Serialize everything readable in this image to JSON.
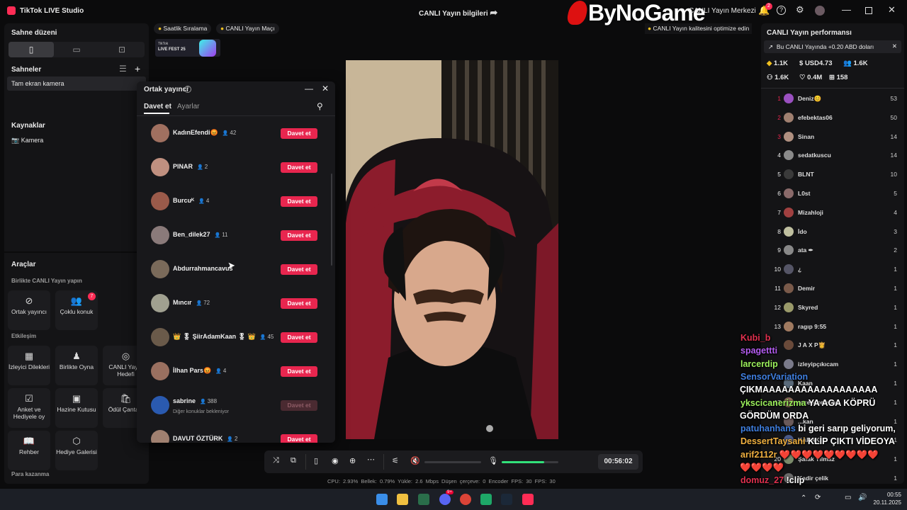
{
  "window": {
    "app_title": "TikTok LIVE Studio",
    "live_info": "CANLI Yayın bilgileri",
    "live_center": "CANLI Yayın Merkezi",
    "notif_count": "2"
  },
  "brand": {
    "text": "ByNoGame"
  },
  "left": {
    "scene_layout_title": "Sahne düzeni",
    "scenes_title": "Sahneler",
    "scene_item": "Tam ekran kamera",
    "sources_title": "Kaynaklar",
    "source_item": "Kamera",
    "tools_title": "Araçlar",
    "together_title": "Birlikte CANLI Yayın yapın",
    "cohost": "Ortak yayıncı",
    "multi_guest": "Çoklu konuk",
    "multi_badge": "7",
    "engagement_title": "Etkileşim",
    "viewer_wishes": "İzleyici Dilekleri",
    "play_together": "Birlikte Oyna",
    "live_goal": "CANLI Yayın Hedefi",
    "poll": "Anket ve Hediyele oy",
    "treasure": "Hazine Kutusu",
    "reward_bag": "Ödül Çantası",
    "guide": "Rehber",
    "gift_gallery": "Hediye Galerisi",
    "monetize_title": "Para kazanma"
  },
  "top_chips": {
    "hourly": "Saatlik Sıralama",
    "match": "CANLI Yayın Maçı",
    "fest_line1": "TikTok",
    "fest_line2": "LIVE FEST 25",
    "quality_tip": "CANLI Yayın kalitesini optimize edin"
  },
  "modal": {
    "title": "Ortak yayıncı",
    "tab_invite": "Davet et",
    "tab_settings": "Ayarlar",
    "invite_label": "Davet et",
    "waiting_text": "Diğer konuklar bekleniyor",
    "rows": [
      {
        "name": "KadınEfendi😡",
        "count": "42",
        "disabled": false
      },
      {
        "name": "PINAR",
        "count": "2",
        "disabled": false
      },
      {
        "name": "Burcuᴷ",
        "count": "4",
        "disabled": false
      },
      {
        "name": "Ben_dilek27",
        "count": "11",
        "disabled": false
      },
      {
        "name": "Abdurrahmancavus",
        "count": "",
        "disabled": false
      },
      {
        "name": "Mıncır",
        "count": "72",
        "disabled": false
      },
      {
        "name": "👑 🎖 ŞiirAdamKaan 🎖 👑",
        "count": "45",
        "disabled": false
      },
      {
        "name": "İlhan Pars😡",
        "count": "4",
        "disabled": false
      },
      {
        "name": "sabrine",
        "count": "388",
        "disabled": true
      },
      {
        "name": "DAVUT ÖZTÜRK",
        "count": "2",
        "disabled": false
      }
    ]
  },
  "controls": {
    "timer": "00:56:02",
    "mic_level_pct": 75
  },
  "stats": {
    "text": "CPU: 2.93%   Bellek: 0.79%   Yükle: 2.6 Mbps   Düşen çerçeve: 0   Encoder FPS: 30   FPS: 30"
  },
  "right": {
    "title": "CANLI Yayın performansı",
    "banner": "Bu CANLI Yayında +0.20 ABD doları",
    "metrics": [
      "1.1K",
      "USD4.73",
      "1.6K",
      "1.6K",
      "0.4M",
      "158"
    ],
    "ranking": [
      {
        "rank": "1",
        "name": "Deniz😊",
        "value": "53"
      },
      {
        "rank": "2",
        "name": "efebektas06",
        "value": "50"
      },
      {
        "rank": "3",
        "name": "Sinan",
        "value": "14"
      },
      {
        "rank": "4",
        "name": "sedatkuscu",
        "value": "14"
      },
      {
        "rank": "5",
        "name": "BLNT",
        "value": "10"
      },
      {
        "rank": "6",
        "name": "L0st",
        "value": "5"
      },
      {
        "rank": "7",
        "name": "Mizahloji",
        "value": "4"
      },
      {
        "rank": "8",
        "name": "İdo",
        "value": "3"
      },
      {
        "rank": "9",
        "name": "ata ✒",
        "value": "2"
      },
      {
        "rank": "10",
        "name": "¿",
        "value": "1"
      },
      {
        "rank": "11",
        "name": "Demir",
        "value": "1"
      },
      {
        "rank": "12",
        "name": "Skyred",
        "value": "1"
      },
      {
        "rank": "13",
        "name": "ragıp 9:55",
        "value": "1"
      },
      {
        "rank": "",
        "name": "J A X P👸",
        "value": "1"
      },
      {
        "rank": "",
        "name": "izleyipçıkıcam",
        "value": "1"
      },
      {
        "rank": "",
        "name": "Kaan",
        "value": "1"
      },
      {
        "rank": "17",
        "name": "recepcorleone",
        "value": "1"
      },
      {
        "rank": "",
        "name": "...kan",
        "value": "1"
      },
      {
        "rank": "",
        "name": "KARAK",
        "value": "1"
      },
      {
        "rank": "20",
        "name": "Şafak Yılmaz",
        "value": "1"
      },
      {
        "rank": "",
        "name": "Kadir çelik",
        "value": "1"
      }
    ]
  },
  "chat": [
    {
      "user": "Kubi_b",
      "msg": "",
      "color": "#e0304e"
    },
    {
      "user": "spagettti",
      "msg": "",
      "color": "#b35cf0"
    },
    {
      "user": "larcerdip",
      "msg": "",
      "color": "#9cf05c"
    },
    {
      "user": "SensorVariation",
      "msg": "",
      "color": "#3f7fe0"
    },
    {
      "user": "",
      "msg": "ÇIKMAAAAAAAAAAAAAAAAAA",
      "color": "#ffffff"
    },
    {
      "user": "ykscicanerizma",
      "msg": "YA AGA KÖPRÜ",
      "color": "#9cf05c"
    },
    {
      "user": "",
      "msg": "GÖRDÜM ORDA",
      "color": "#ffffff"
    },
    {
      "user": "patuhanhans",
      "msg": "bi geri sarıp geliyorum,",
      "color": "#3f7fe0"
    },
    {
      "user": "DessertTaysani",
      "msg": "KLİP ÇIKTI VİDEOYA",
      "color": "#f0b040"
    },
    {
      "user": "arif2112r",
      "msg": "❤️❤️❤️❤️❤️❤️❤️❤️❤️",
      "color": "#f0b040"
    },
    {
      "user": "",
      "msg": "❤️❤️❤️❤️",
      "color": "#ffffff"
    },
    {
      "user": "domuz_27",
      "msg": "!clip",
      "color": "#e0304e"
    }
  ],
  "taskbar": {
    "time": "00:55",
    "date": "20.11.2025",
    "discord_badge": "9+"
  }
}
